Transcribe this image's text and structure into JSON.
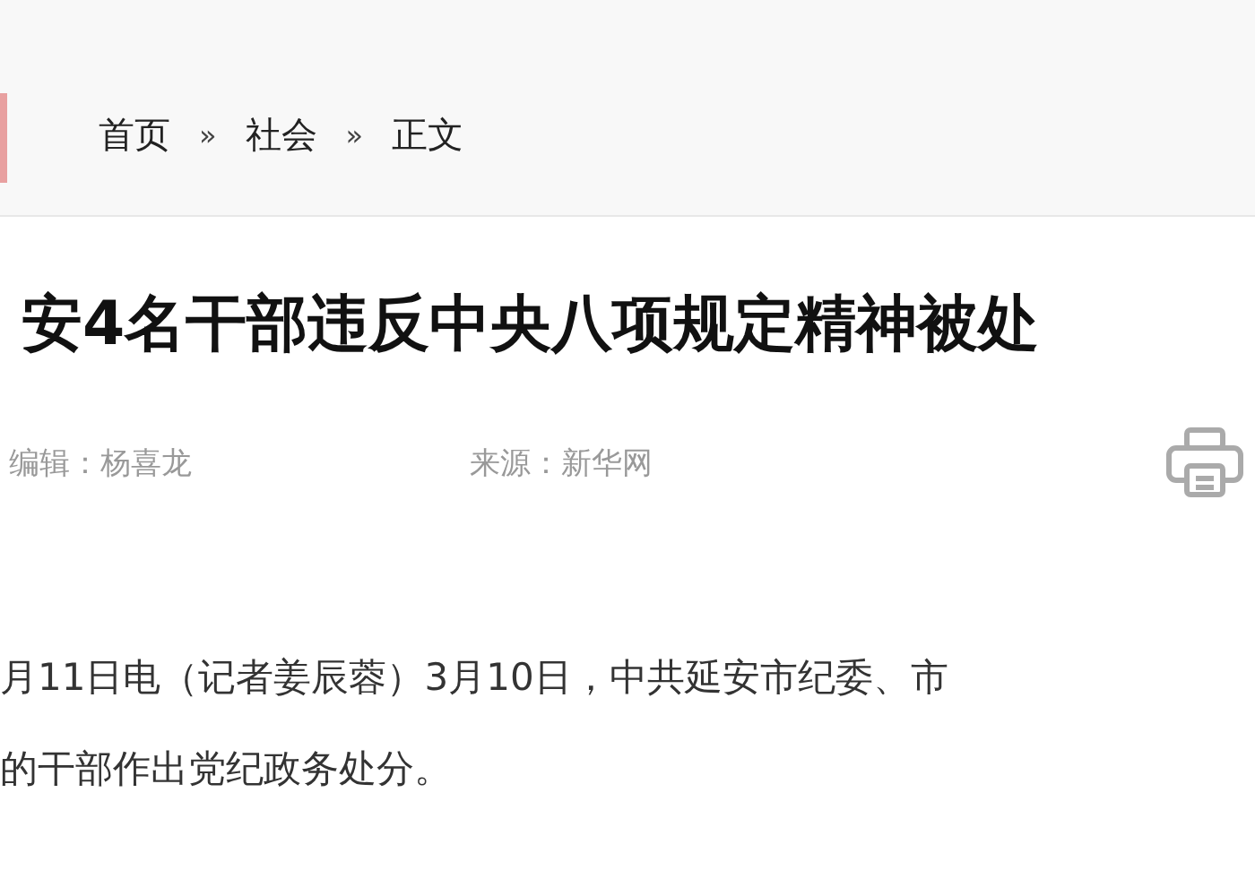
{
  "breadcrumb": [
    {
      "label": "首页"
    },
    {
      "label": "社会"
    },
    {
      "label": "正文"
    }
  ],
  "breadcrumb_separator": "»",
  "title": "安4名干部违反中央八项规定精神被处",
  "meta": [
    "编辑：杨喜龙",
    "来源：新华网"
  ],
  "paragraph_lines": [
    "月11日电（记者姜辰蓉）3月10日，中共延安市纪委、市",
    "的干部作出党纪政务处分。"
  ]
}
